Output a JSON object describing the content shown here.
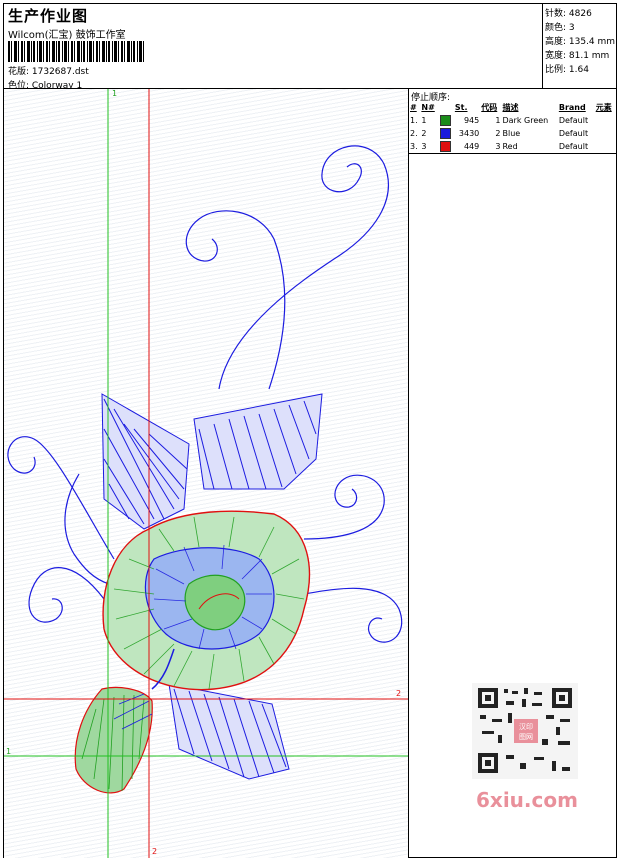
{
  "header": {
    "title": "生产作业图",
    "subtitle": "Wilcom(汇宝) 鼓饰工作室",
    "design_file": "花版: 1732687.dst",
    "colorway": "色位: Colorway 1"
  },
  "stats": {
    "stitches": "针数: 4826",
    "colors": "颜色: 3",
    "height": "高度: 135.4 mm",
    "width": "宽度: 81.1 mm",
    "ratio": "比例: 1.64"
  },
  "stop_sequence": {
    "title": "停止顺序:",
    "headers": [
      "#",
      "N#",
      "",
      "St.",
      "代码",
      "描述",
      "Brand",
      "元素"
    ],
    "rows": [
      {
        "num": "1.",
        "n": "1",
        "color": "#1a8c1a",
        "st": "945",
        "code": "1",
        "desc": "Dark Green",
        "brand": "Default"
      },
      {
        "num": "2.",
        "n": "2",
        "color": "#1a1adc",
        "st": "3430",
        "code": "2",
        "desc": "Blue",
        "brand": "Default"
      },
      {
        "num": "3.",
        "n": "3",
        "color": "#e01010",
        "st": "449",
        "code": "3",
        "desc": "Red",
        "brand": "Default"
      }
    ]
  },
  "guides": {
    "green_top": "1",
    "green_left": "1",
    "red_right": "2",
    "red_bottom": "2"
  },
  "watermark": {
    "logo_text": "6xiu.com",
    "seal_text": "汉印图网"
  },
  "colors": {
    "green": "#22a022",
    "blue": "#1c1ce0",
    "red": "#e01010"
  }
}
